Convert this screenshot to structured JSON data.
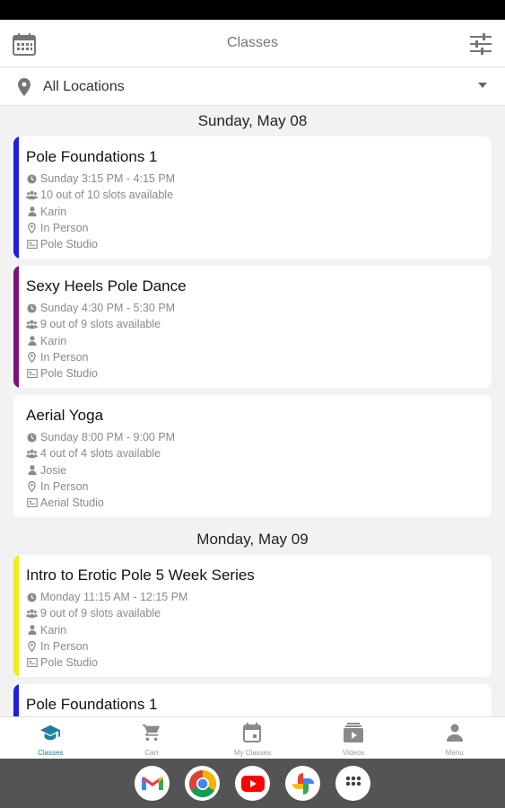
{
  "header": {
    "title": "Classes"
  },
  "location": {
    "label": "All Locations"
  },
  "days": [
    {
      "label": "Sunday, May 08",
      "classes": [
        {
          "name": "Pole Foundations 1",
          "time": "Sunday 3:15 PM - 4:15 PM",
          "slots": "10 out of 10 slots available",
          "instructor": "Karin",
          "mode": "In Person",
          "room": "Pole Studio",
          "accent": "#1f1fe0"
        },
        {
          "name": "Sexy Heels Pole Dance",
          "time": "Sunday 4:30 PM - 5:30 PM",
          "slots": "9 out of 9 slots available",
          "instructor": "Karin",
          "mode": "In Person",
          "room": "Pole Studio",
          "accent": "#7a1478"
        },
        {
          "name": "Aerial Yoga",
          "time": "Sunday 8:00 PM - 9:00 PM",
          "slots": "4 out of 4 slots available",
          "instructor": "Josie",
          "mode": "In Person",
          "room": "Aerial Studio",
          "accent": "#ffffff"
        }
      ]
    },
    {
      "label": "Monday, May 09",
      "classes": [
        {
          "name": "Intro to Erotic Pole 5 Week Series",
          "time": "Monday 11:15 AM - 12:15 PM",
          "slots": "9 out of 9 slots available",
          "instructor": "Karin",
          "mode": "In Person",
          "room": "Pole Studio",
          "accent": "#f4ec1a"
        },
        {
          "name": "Pole Foundations 1",
          "time": "",
          "slots": "",
          "instructor": "",
          "mode": "",
          "room": "",
          "accent": "#1f1fe0"
        }
      ]
    }
  ],
  "nav": [
    {
      "label": "Classes",
      "icon": "graduation-cap-icon",
      "active": true
    },
    {
      "label": "Cart",
      "icon": "cart-icon",
      "active": false
    },
    {
      "label": "My Classes",
      "icon": "calendar-icon",
      "active": false
    },
    {
      "label": "Videos",
      "icon": "video-library-icon",
      "active": false
    },
    {
      "label": "Menu",
      "icon": "person-icon",
      "active": false
    }
  ],
  "dock": [
    "gmail-icon",
    "chrome-icon",
    "youtube-icon",
    "photos-icon",
    "app-drawer-icon"
  ],
  "colors": {
    "active_nav": "#1e7ea1",
    "icon_gray": "#757575"
  }
}
